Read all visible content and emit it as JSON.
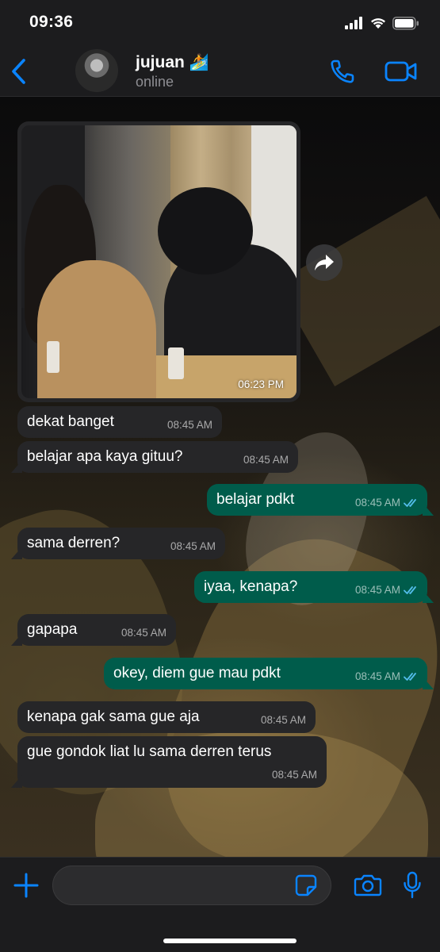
{
  "status_bar": {
    "time": "09:36"
  },
  "header": {
    "contact_name": "jujuan",
    "name_emoji": "🏄",
    "contact_status": "online"
  },
  "photo_message": {
    "time": "06:23 PM"
  },
  "messages": [
    {
      "direction": "in",
      "text": "dekat banget",
      "time": "08:45 AM"
    },
    {
      "direction": "in",
      "text": "belajar apa kaya gituu?",
      "time": "08:45 AM"
    },
    {
      "direction": "out",
      "text": "belajar pdkt",
      "time": "08:45 AM"
    },
    {
      "direction": "in",
      "text": "sama derren?",
      "time": "08:45 AM"
    },
    {
      "direction": "out",
      "text": "iyaa, kenapa?",
      "time": "08:45 AM"
    },
    {
      "direction": "in",
      "text": "gapapa",
      "time": "08:45 AM"
    },
    {
      "direction": "out",
      "text": "okey, diem gue mau pdkt",
      "time": "08:45 AM"
    },
    {
      "direction": "in",
      "text": "kenapa gak sama gue aja",
      "time": "08:45 AM"
    },
    {
      "direction": "in",
      "text": "gue gondok liat lu sama derren terus",
      "time": "08:45 AM"
    }
  ],
  "colors": {
    "accent": "#0a84ff",
    "outgoing_bubble": "#005c4b",
    "incoming_bubble": "#262628",
    "read_ticks": "#53bdeb"
  },
  "icons": {
    "back": "chevron-left-icon",
    "call": "phone-icon",
    "video": "video-camera-icon",
    "forward": "forward-arrow-icon",
    "plus": "plus-icon",
    "sticker": "sticker-icon",
    "camera": "camera-icon",
    "mic": "microphone-icon"
  }
}
